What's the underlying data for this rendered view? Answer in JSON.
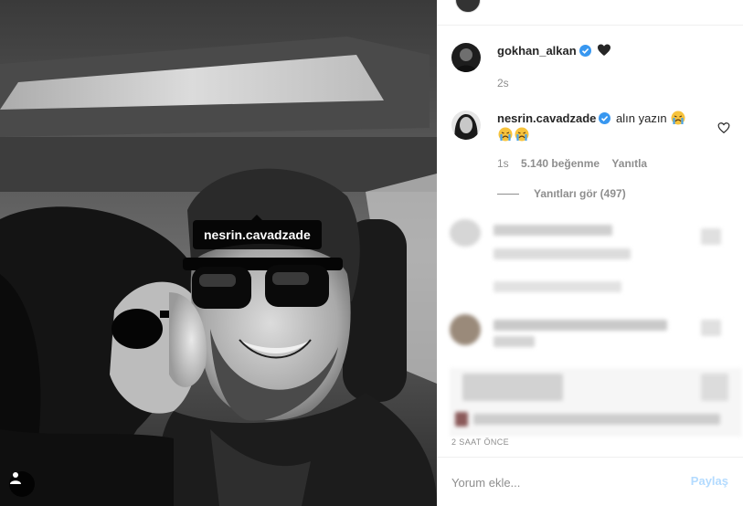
{
  "tag": {
    "username": "nesrin.cavadzade"
  },
  "comments": [
    {
      "username": "gokhan_alkan",
      "verified": true,
      "text": "",
      "emoji": [
        "black-heart"
      ],
      "time": "2s"
    },
    {
      "username": "nesrin.cavadzade",
      "verified": true,
      "text": "alın yazın",
      "emoji": [
        "crying-face",
        "crying-face",
        "crying-face"
      ],
      "time": "1s",
      "likes": "5.140 beğenme",
      "reply_label": "Yanıtla",
      "view_replies": "Yanıtları gör (497)"
    }
  ],
  "post": {
    "timestamp": "2 SAAT ÖNCE"
  },
  "add_comment": {
    "placeholder": "Yorum ekle...",
    "post_label": "Paylaş"
  },
  "colors": {
    "verified": "#3897f0",
    "post_disabled": "#b3dbff",
    "muted": "#8e8e8e"
  }
}
